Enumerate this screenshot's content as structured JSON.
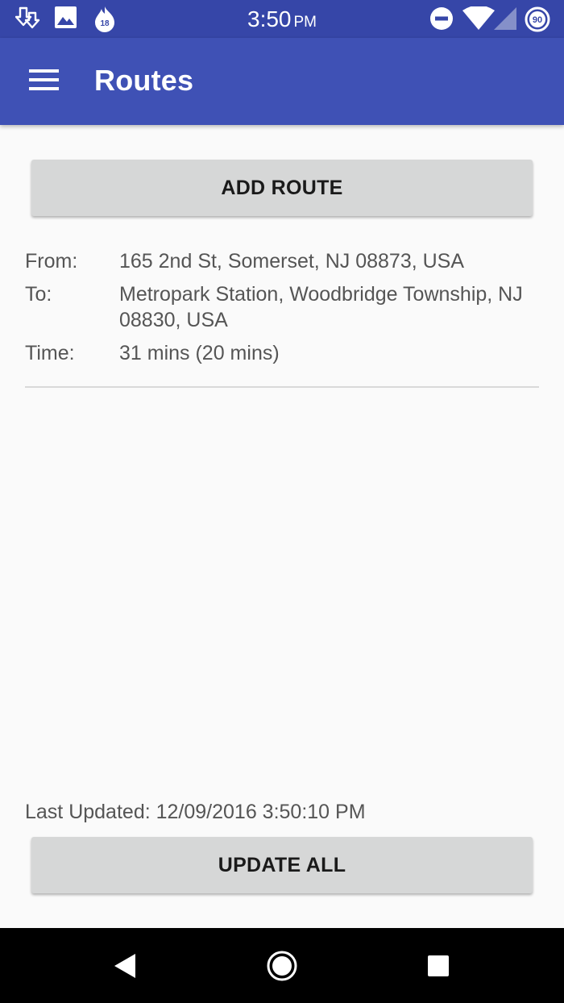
{
  "status_bar": {
    "time": "3:50",
    "ampm": "PM",
    "notification_badge": "18",
    "battery_level": "90",
    "icons": [
      "download-icon",
      "image-icon",
      "app-badge-icon",
      "do-not-disturb-icon",
      "wifi-icon",
      "signal-icon",
      "battery-saver-icon"
    ]
  },
  "app_bar": {
    "title": "Routes",
    "menu_icon": "hamburger-menu-icon",
    "background_color": "#3f51b5",
    "status_bar_color": "#3646a8"
  },
  "add_route_button": {
    "label": "ADD ROUTE"
  },
  "route": {
    "from_label": "From:",
    "from_value": "165 2nd St, Somerset, NJ 08873, USA",
    "to_label": "To:",
    "to_value": "Metropark Station, Woodbridge Township, NJ 08830, USA",
    "time_label": "Time:",
    "time_value": "31 mins (20 mins)"
  },
  "last_updated": "Last Updated: 12/09/2016 3:50:10 PM",
  "update_all_button": {
    "label": "UPDATE ALL"
  },
  "nav_bar": {
    "icons": [
      "back-icon",
      "home-icon",
      "recents-icon"
    ]
  }
}
